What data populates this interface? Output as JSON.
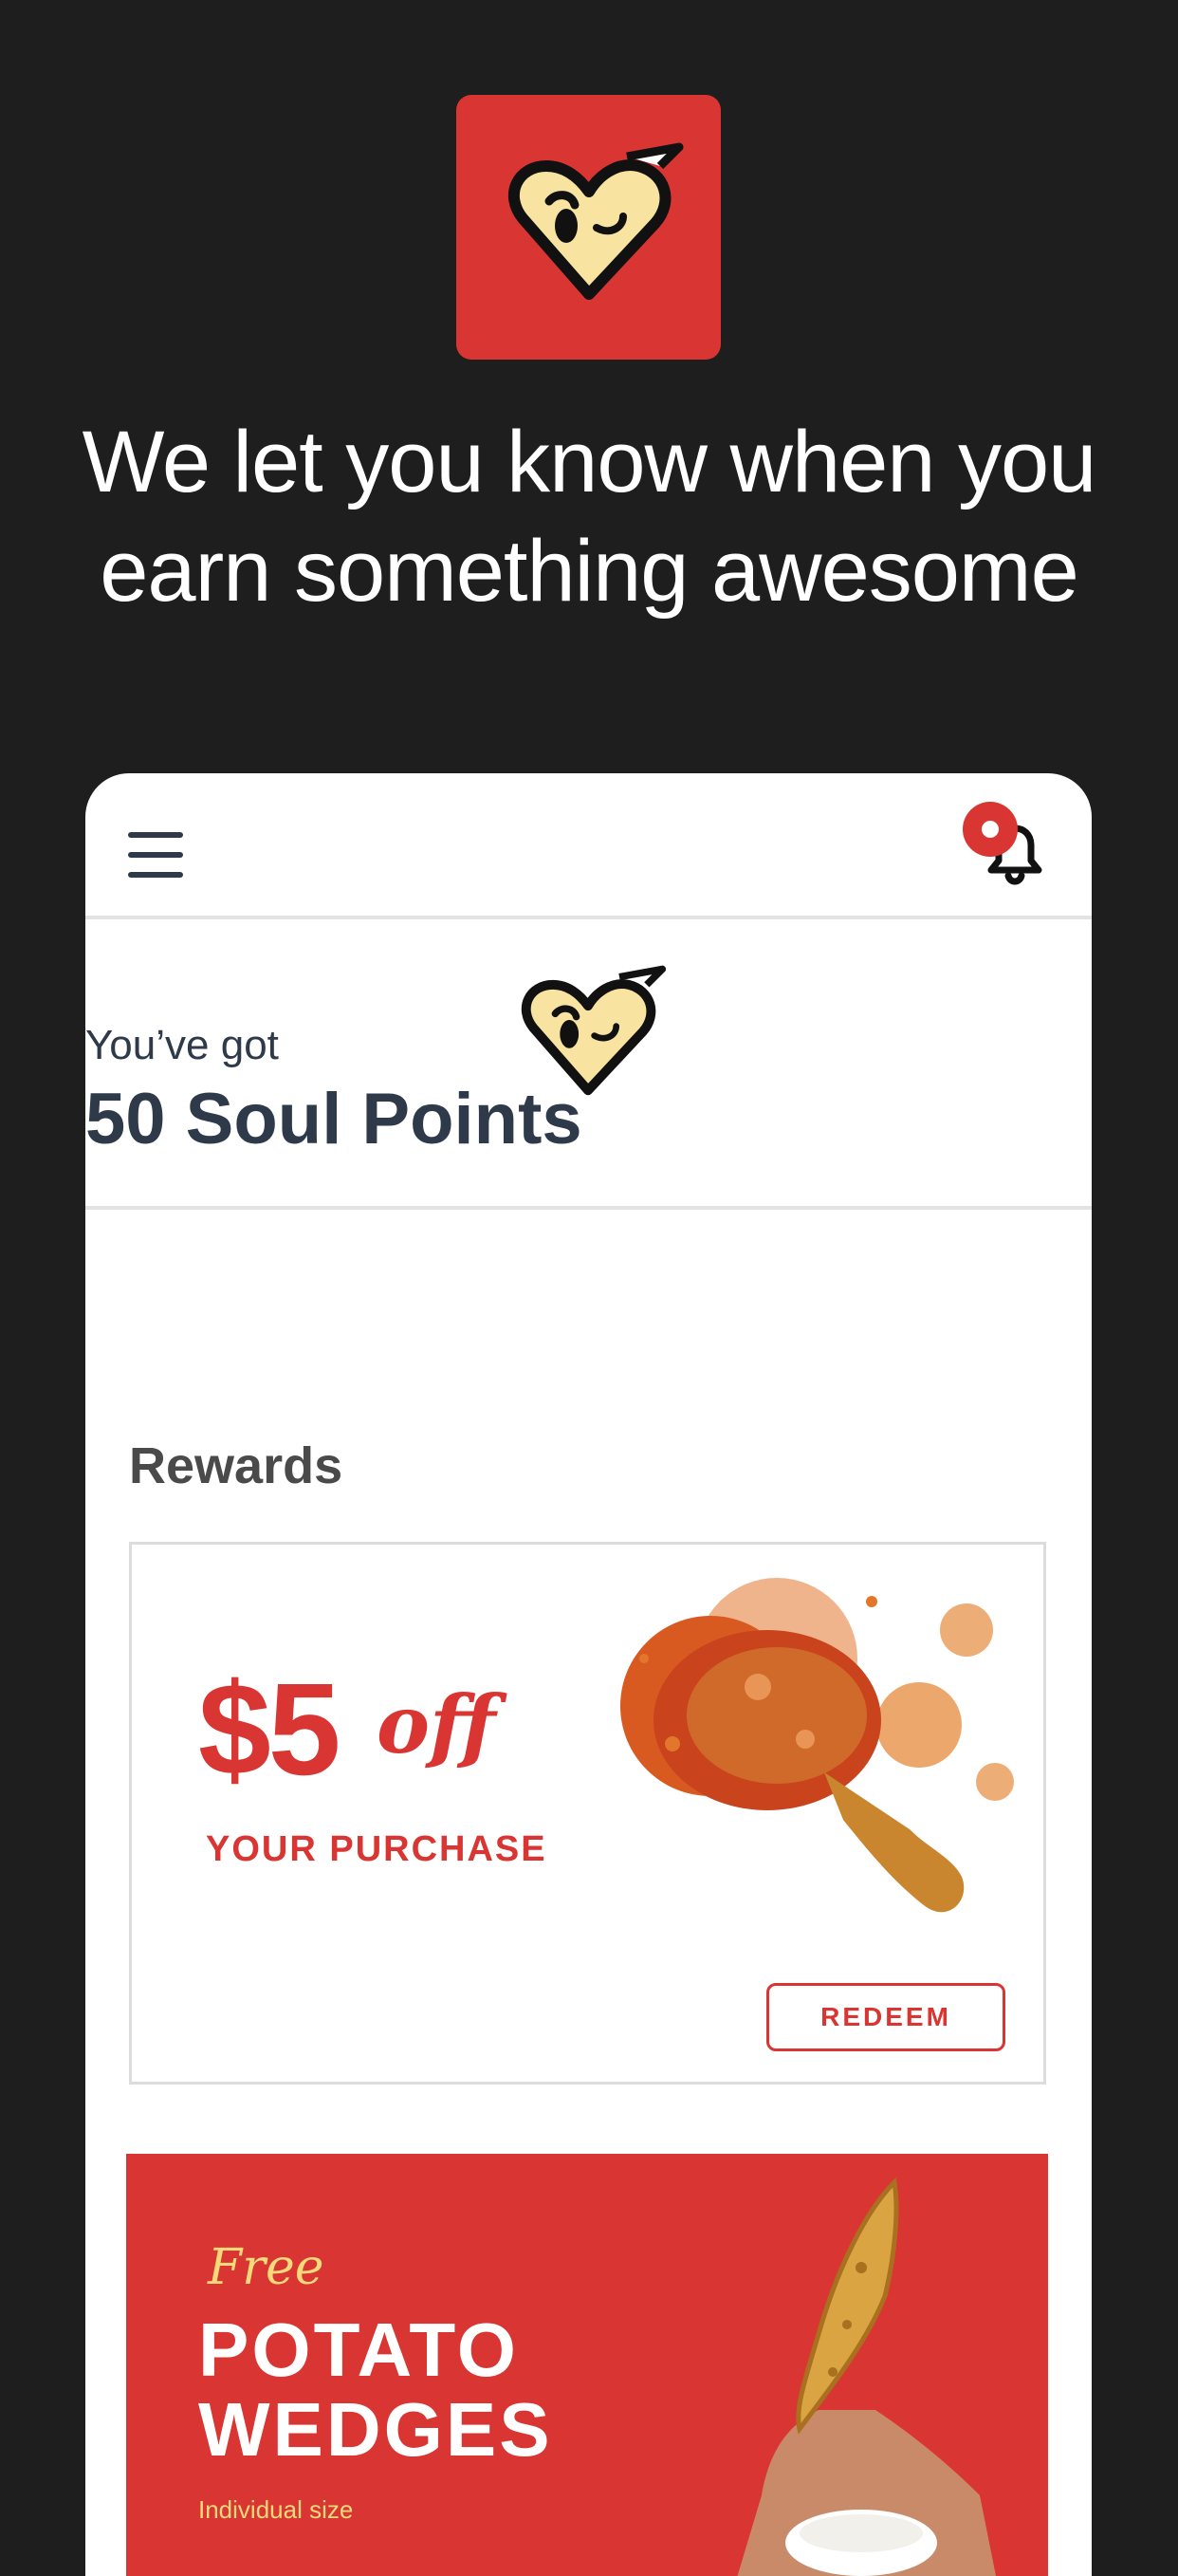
{
  "promo": {
    "headline": "We let you know when you earn something awesome"
  },
  "app": {
    "points_subtitle": "You’ve got",
    "points_title": "50 Soul Points",
    "rewards_title": "Rewards"
  },
  "rewards": [
    {
      "amount": "$5",
      "amount_suffix": "off",
      "subtitle": "YOUR PURCHASE",
      "button_label": "REDEEM"
    },
    {
      "prefix": "Free",
      "title": "POTATO WEDGES",
      "note": "Individual size"
    }
  ],
  "colors": {
    "brand_red": "#d93532",
    "dark_bg": "#1e1e1e",
    "text_dark": "#2e3a4a",
    "cream": "#f8e4a0"
  },
  "icons": {
    "menu": "hamburger-menu-icon",
    "notifications": "bell-icon",
    "brand": "heart-bird-logo"
  }
}
